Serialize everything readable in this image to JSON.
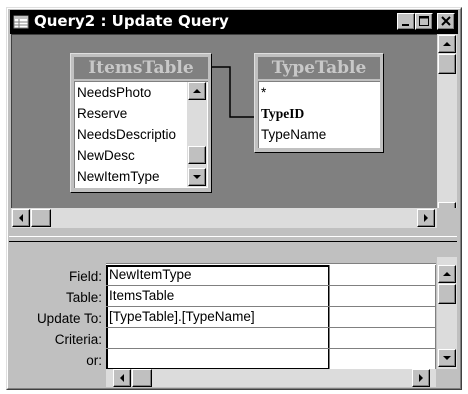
{
  "window": {
    "title": "Query2 : Update Query"
  },
  "tables": [
    {
      "name": "ItemsTable",
      "fields": [
        "NeedsPhoto",
        "Reserve",
        "NeedsDescriptio",
        "NewDesc",
        "NewItemType"
      ]
    },
    {
      "name": "TypeTable",
      "fields": [
        "*",
        "TypeID",
        "TypeName"
      ],
      "bold_field": "TypeID"
    }
  ],
  "grid": {
    "row_labels": [
      "Field:",
      "Table:",
      "Update To:",
      "Criteria:",
      "or:"
    ],
    "columns": [
      {
        "field": "NewItemType",
        "table": "ItemsTable",
        "update_to": "[TypeTable].[TypeName]",
        "criteria": "",
        "or": ""
      },
      {
        "field": "",
        "table": "",
        "update_to": "",
        "criteria": "",
        "or": ""
      }
    ]
  },
  "icons": {
    "title_icon": "query-icon",
    "minimize": "minimize-icon",
    "maximize": "maximize-icon",
    "close": "close-icon"
  }
}
